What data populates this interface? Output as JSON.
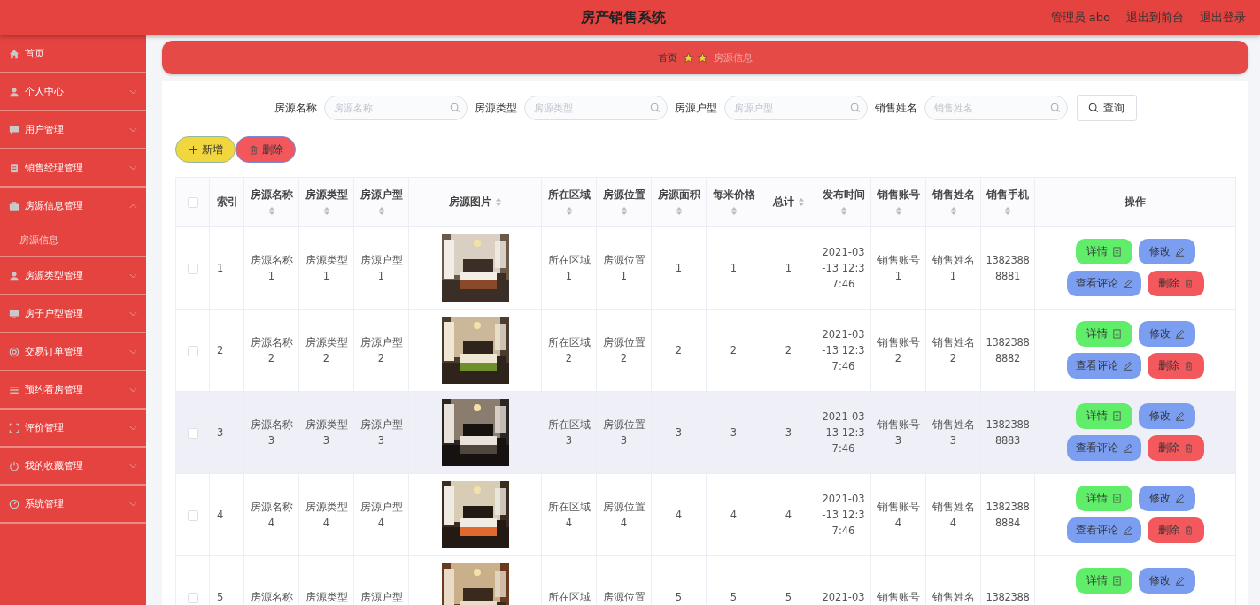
{
  "header": {
    "title": "房产销售系统",
    "links": [
      "管理员 abo",
      "退出到前台",
      "退出登录"
    ]
  },
  "sidebar": {
    "items": [
      {
        "label": "首页",
        "kind": "link"
      },
      {
        "label": "个人中心",
        "kind": "menu",
        "expanded": false
      },
      {
        "label": "用户管理",
        "kind": "menu",
        "expanded": false
      },
      {
        "label": "销售经理管理",
        "kind": "menu",
        "expanded": false
      },
      {
        "label": "房源信息管理",
        "kind": "menu",
        "expanded": true,
        "children": [
          {
            "label": "房源信息",
            "selected": true
          }
        ]
      },
      {
        "label": "房源类型管理",
        "kind": "menu",
        "expanded": false
      },
      {
        "label": "房子户型管理",
        "kind": "menu",
        "expanded": false
      },
      {
        "label": "交易订单管理",
        "kind": "menu",
        "expanded": false
      },
      {
        "label": "预约看房管理",
        "kind": "menu",
        "expanded": false
      },
      {
        "label": "评价管理",
        "kind": "menu",
        "expanded": false
      },
      {
        "label": "我的收藏管理",
        "kind": "menu",
        "expanded": false
      },
      {
        "label": "系统管理",
        "kind": "menu",
        "expanded": false
      }
    ]
  },
  "breadcrumb": [
    {
      "label": "首页",
      "selected": false
    },
    {
      "label": "房源信息",
      "selected": true
    }
  ],
  "search": {
    "fields": [
      {
        "label": "房源名称",
        "placeholder": "房源名称"
      },
      {
        "label": "房源类型",
        "placeholder": "房源类型"
      },
      {
        "label": "房源户型",
        "placeholder": "房源户型"
      },
      {
        "label": "销售姓名",
        "placeholder": "销售姓名"
      }
    ],
    "button": "查询"
  },
  "toolbar": {
    "add": "新增",
    "delete": "删除"
  },
  "table": {
    "all_checked": false,
    "columns": [
      {
        "label": "索引",
        "sortable": false
      },
      {
        "label": "房源名称",
        "sortable": true
      },
      {
        "label": "房源类型",
        "sortable": true
      },
      {
        "label": "房源户型",
        "sortable": true
      },
      {
        "label": "房源图片",
        "sortable": true
      },
      {
        "label": "所在区域",
        "sortable": true
      },
      {
        "label": "房源位置",
        "sortable": true
      },
      {
        "label": "房源面积",
        "sortable": true
      },
      {
        "label": "每米价格",
        "sortable": true
      },
      {
        "label": "总计",
        "sortable": true
      },
      {
        "label": "发布时间",
        "sortable": true
      },
      {
        "label": "销售账号",
        "sortable": true
      },
      {
        "label": "销售姓名",
        "sortable": true
      },
      {
        "label": "销售手机",
        "sortable": true
      },
      {
        "label": "操作",
        "sortable": false
      }
    ],
    "rows": [
      {
        "checked": false,
        "hovered": false,
        "cells": [
          "1",
          "房源名称1",
          "房源类型1",
          "房源户型1",
          {
            "kind": "picture"
          },
          "所在区域1",
          "房源位置1",
          "1",
          "1",
          "1",
          "2021-03-13 12:37:46",
          "销售账号1",
          "销售姓名1",
          "13823888881"
        ],
        "actions": [
          "详情",
          "修改",
          "查看评论",
          "删除"
        ]
      },
      {
        "checked": false,
        "hovered": false,
        "cells": [
          "2",
          "房源名称2",
          "房源类型2",
          "房源户型2",
          {
            "kind": "picture"
          },
          "所在区域2",
          "房源位置2",
          "2",
          "2",
          "2",
          "2021-03-13 12:37:46",
          "销售账号2",
          "销售姓名2",
          "13823888882"
        ],
        "actions": [
          "详情",
          "修改",
          "查看评论",
          "删除"
        ]
      },
      {
        "checked": false,
        "hovered": true,
        "cells": [
          "3",
          "房源名称3",
          "房源类型3",
          "房源户型3",
          {
            "kind": "picture"
          },
          "所在区域3",
          "房源位置3",
          "3",
          "3",
          "3",
          "2021-03-13 12:37:46",
          "销售账号3",
          "销售姓名3",
          "13823888883"
        ],
        "actions": [
          "详情",
          "修改",
          "查看评论",
          "删除"
        ]
      },
      {
        "checked": false,
        "hovered": false,
        "cells": [
          "4",
          "房源名称4",
          "房源类型4",
          "房源户型4",
          {
            "kind": "picture"
          },
          "所在区域4",
          "房源位置4",
          "4",
          "4",
          "4",
          "2021-03-13 12:37:46",
          "销售账号4",
          "销售姓名4",
          "13823888884"
        ],
        "actions": [
          "详情",
          "修改",
          "查看评论",
          "删除"
        ]
      },
      {
        "checked": false,
        "hovered": false,
        "cells": [
          "5",
          "房源名称",
          "房源类型",
          "房源户型",
          {
            "kind": "picture"
          },
          "所在区域",
          "房源位置",
          "5",
          "5",
          "5",
          "2021-03",
          "销售账号",
          "销售姓名",
          "1382388"
        ],
        "actions": [
          "详情",
          "修改"
        ]
      }
    ]
  }
}
